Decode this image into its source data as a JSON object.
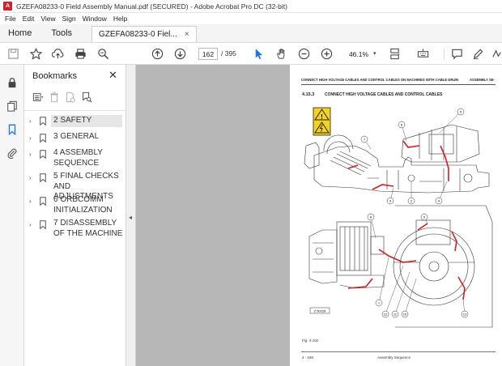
{
  "window": {
    "title": "GZEFA08233-0 Field Assembly Manual.pdf (SECURED) - Adobe Acrobat Pro DC (32-bit)",
    "app_icon_glyph": "A"
  },
  "menu": [
    "File",
    "Edit",
    "View",
    "Sign",
    "Window",
    "Help"
  ],
  "tabs": {
    "home": "Home",
    "tools": "Tools",
    "document": "GZEFA08233-0 Fiel...",
    "close_glyph": "×"
  },
  "toolbar": {
    "current_page": "162",
    "total_pages": "/ 395",
    "zoom": "46.1%",
    "zoom_caret": "▾"
  },
  "bookmarks": {
    "title": "Bookmarks",
    "close_glyph": "✕",
    "items": [
      {
        "label": "2 SAFETY",
        "selected": true
      },
      {
        "label": "3 GENERAL",
        "selected": false
      },
      {
        "label": "4 ASSEMBLY SEQUENCE",
        "selected": false
      },
      {
        "label": "5 FINAL CHECKS AND ADJUSTMENTS",
        "selected": false
      },
      {
        "label": "6 ORBCOMM INITIALIZATION",
        "selected": false
      },
      {
        "label": "7 DISASSEMBLY OF THE MACHINE",
        "selected": false
      }
    ],
    "chevron_glyph": "›"
  },
  "splitter": {
    "arrow_glyph": "◂"
  },
  "pdf_page": {
    "header_left": "CONNECT HIGH VOLTAGE CABLES AND CONTROL CABLES ON MACHINES WITH CABLE DRUM",
    "header_right": "ASSEMBLY SE-",
    "section_number": "4.15.3",
    "section_title": "CONNECT HIGH VOLTAGE CABLES AND CONTROL CABLES",
    "figure_id": "Z 50228",
    "figure_caption": "Fig. 4-102",
    "footer_left": "4 - 160",
    "footer_center": "Assembly Sequence",
    "callouts": [
      "1",
      "2",
      "3",
      "4",
      "5",
      "6",
      "7",
      "8",
      "9",
      "10",
      "11",
      "12",
      "13"
    ]
  },
  "colors": {
    "acrobat_red": "#d4202a",
    "active_blue": "#1a73e8",
    "cable_red": "#d21f1f",
    "warning_yellow": "#f3d31b",
    "doc_background": "#b7b7b7"
  }
}
